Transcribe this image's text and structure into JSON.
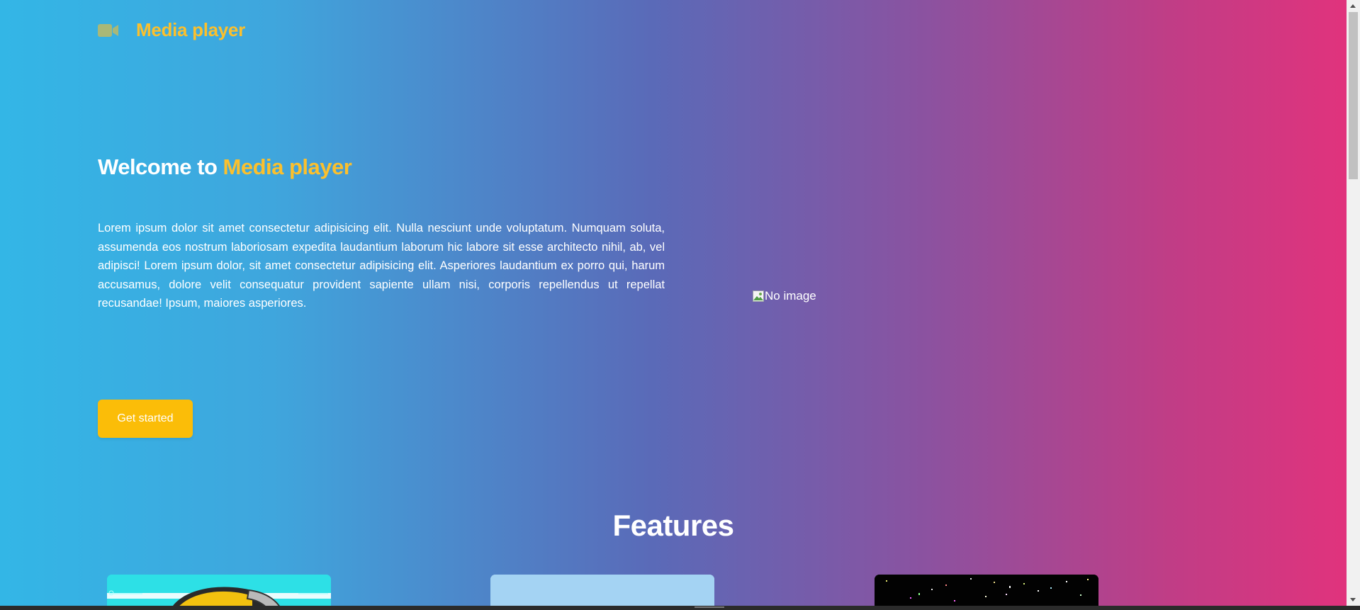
{
  "navbar": {
    "brand_icon": "video-camera-icon",
    "brand_name": "Media player"
  },
  "hero": {
    "title_prefix": "Welcome to ",
    "title_accent": "Media player",
    "text": "Lorem ipsum dolor sit amet consectetur adipisicing elit. Nulla nesciunt unde voluptatum. Numquam soluta, assumenda eos nostrum laboriosam expedita laudantium laborum hic labore sit esse architecto nihil, ab, vel adipisci! Lorem ipsum dolor, sit amet consectetur adipisicing elit. Asperiores laudantium ex porro qui, harum accusamus, dolore velit consequatur provident sapiente ullam nisi, corporis repellendus ut repellat recusandae! Ipsum, maiores asperiores.",
    "cta_label": "Get started",
    "image_alt": "No image"
  },
  "features": {
    "title": "Features"
  },
  "colors": {
    "accent": "#fbc02d",
    "button": "#fbbd08",
    "gradient_start": "#33b6e6",
    "gradient_mid": "#5a6ab8",
    "gradient_end": "#e3327c"
  }
}
